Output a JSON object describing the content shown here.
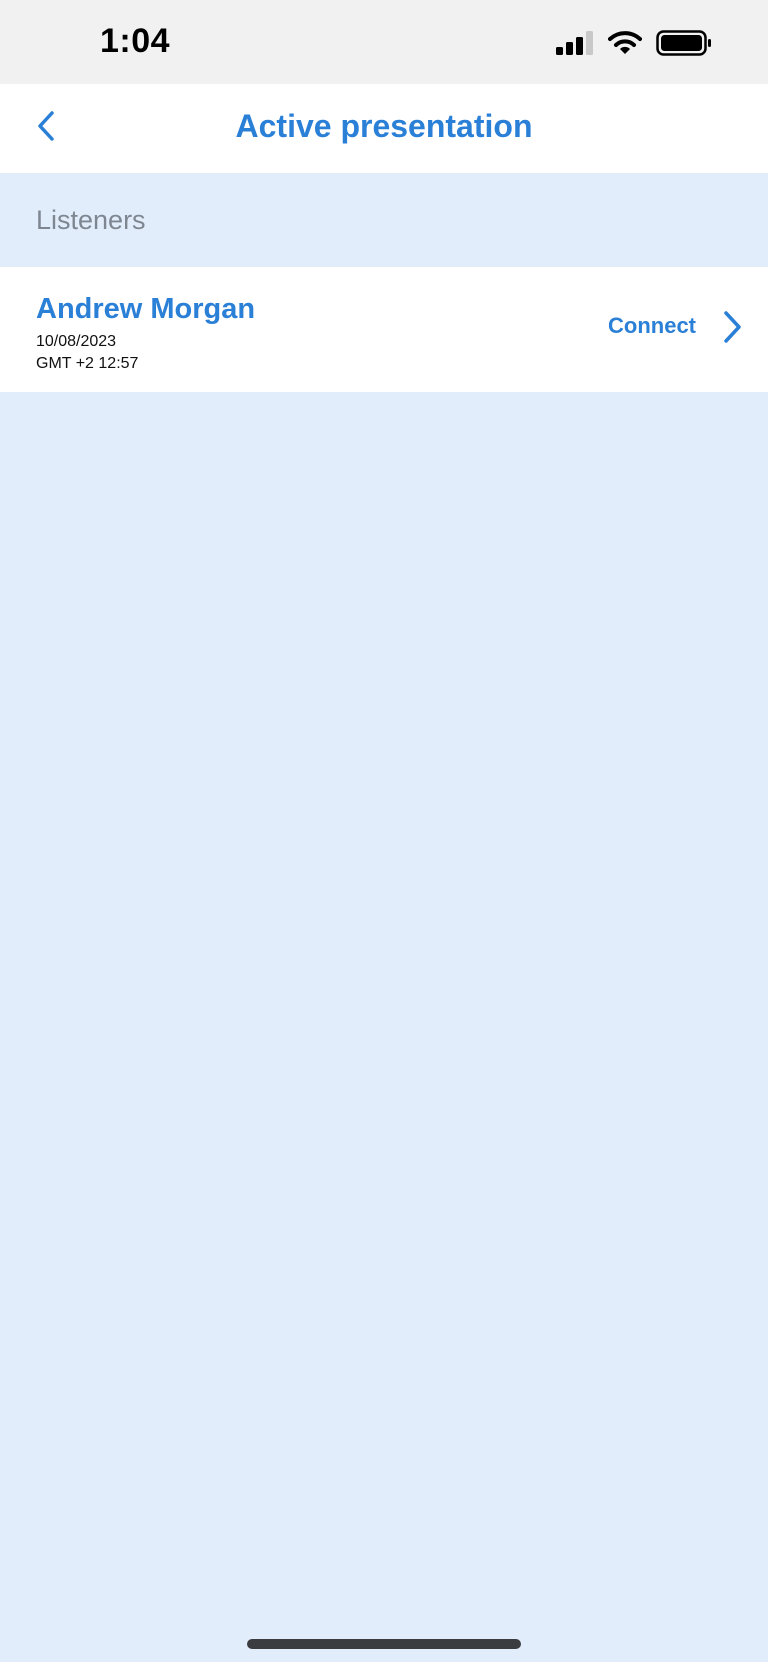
{
  "status_bar": {
    "time": "1:04",
    "icons": [
      "cellular-signal-icon",
      "wifi-icon",
      "battery-icon"
    ]
  },
  "nav": {
    "back_icon": "chevron-left-icon",
    "title": "Active presentation"
  },
  "listeners": {
    "section_label": "Listeners",
    "items": [
      {
        "name": "Andrew Morgan",
        "date": "10/08/2023",
        "time": "GMT +2 12:57",
        "action_label": "Connect"
      }
    ]
  },
  "colors": {
    "accent": "#2a7fd6",
    "background": "#e1edfb",
    "surface": "#ffffff",
    "status_bar": "#f1f1f1",
    "secondary_text": "#7e8791"
  }
}
